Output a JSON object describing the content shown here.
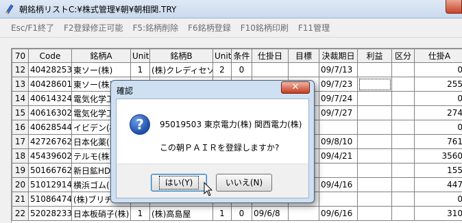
{
  "window": {
    "title": "朝銘柄リストC:¥株式管理¥朝¥朝相関.TRY"
  },
  "menu": {
    "items": [
      "Esc/F1終了",
      "F2登録修正可能",
      "F5:銘柄削除",
      "F6銘柄登録",
      "F10銘柄印刷",
      "F11管理"
    ]
  },
  "grid": {
    "headers": [
      "70",
      "Code",
      "銘柄A",
      "Unit",
      "銘柄B",
      "Unit",
      "条件",
      "仕掛日",
      "目標",
      "決裁期日",
      "利益",
      "区分",
      "仕掛A"
    ],
    "rows": [
      [
        "12",
        "40428253",
        "東ソー(株)",
        "1",
        "(株)クレディセゾン",
        "2",
        "0",
        "",
        "",
        "09/7/13",
        "",
        "",
        "0"
      ],
      [
        "13",
        "40428601",
        "東ソー(株)",
        "",
        "",
        "",
        "",
        "",
        "",
        "09/7/23",
        "",
        "",
        "255"
      ],
      [
        "14",
        "40614324",
        "電気化学工",
        "",
        "",
        "",
        "",
        "",
        "",
        "09/7/24",
        "",
        "",
        "0"
      ],
      [
        "15",
        "40616302",
        "電気化学工",
        "",
        "",
        "",
        "",
        "",
        "",
        "09/7/27",
        "",
        "",
        "274"
      ],
      [
        "16",
        "40628544",
        "イビデン(株",
        "",
        "",
        "",
        "",
        "",
        "",
        "",
        "",
        "",
        "0"
      ],
      [
        "17",
        "42726762",
        "日本化薬(",
        "",
        "",
        "",
        "",
        "",
        "",
        "09/8/10",
        "",
        "",
        "761"
      ],
      [
        "18",
        "45439602",
        "テルモ(株)",
        "",
        "",
        "",
        "",
        "",
        "",
        "09/4/21",
        "",
        "",
        "3560"
      ],
      [
        "19",
        "50166762",
        "新日鉱HD",
        "",
        "",
        "",
        "",
        "",
        "",
        "",
        "",
        "",
        "155"
      ],
      [
        "20",
        "51012914",
        "横浜ゴム(",
        "",
        "",
        "",
        "",
        "",
        "",
        "09/4/16",
        "",
        "",
        "447"
      ],
      [
        "21",
        "51086474",
        "(株)ブリヂ",
        "",
        "",
        "",
        "",
        "",
        "",
        "",
        "",
        "",
        "0"
      ],
      [
        "22",
        "52028233",
        "日本板硝子(株)",
        "1",
        "(株)高島屋",
        "1",
        "0",
        "09/6/8",
        "",
        "09/6/16",
        "",
        "",
        "310"
      ]
    ]
  },
  "dialog": {
    "title": "確認",
    "line1": "95019503 東京電力(株) 関西電力(株)",
    "line2": "この朝ＰＡＩＲを登録しますか?",
    "yes_label": "はい(Y)",
    "no_label": "いいえ(N)"
  }
}
